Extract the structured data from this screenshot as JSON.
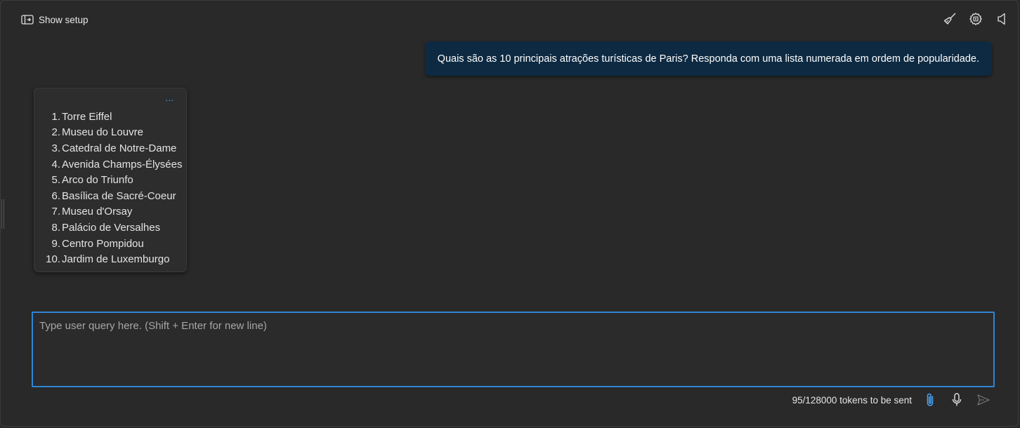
{
  "topbar": {
    "show_setup_label": "Show setup",
    "icons": [
      "show-setup-icon",
      "broom-icon",
      "settings-gear-icon",
      "speaker-icon"
    ]
  },
  "conversation": {
    "user_message": "Quais são as 10 principais atrações turísticas de Paris? Responda com uma lista numerada em ordem de popularidade.",
    "assistant_menu": "...",
    "assistant_items": [
      {
        "num": "1.",
        "text": "Torre Eiffel"
      },
      {
        "num": "2.",
        "text": "Museu do Louvre"
      },
      {
        "num": "3.",
        "text": "Catedral de Notre-Dame"
      },
      {
        "num": "4.",
        "text": "Avenida Champs-Élysées"
      },
      {
        "num": "5.",
        "text": "Arco do Triunfo"
      },
      {
        "num": "6.",
        "text": "Basílica de Sacré-Coeur"
      },
      {
        "num": "7.",
        "text": "Museu d'Orsay"
      },
      {
        "num": "8.",
        "text": "Palácio de Versalhes"
      },
      {
        "num": "9.",
        "text": "Centro Pompidou"
      },
      {
        "num": "10.",
        "text": "Jardim de Luxemburgo"
      }
    ]
  },
  "input": {
    "placeholder": "Type user query here. (Shift + Enter for new line)",
    "value": ""
  },
  "footer": {
    "tokens_label": "95/128000 tokens to be sent",
    "icons": [
      "paperclip-icon",
      "microphone-icon",
      "send-icon"
    ]
  },
  "colors": {
    "background": "#292929",
    "user_bubble": "#0e2a42",
    "accent": "#2f86d6",
    "menu_dots": "#3c9be8"
  }
}
